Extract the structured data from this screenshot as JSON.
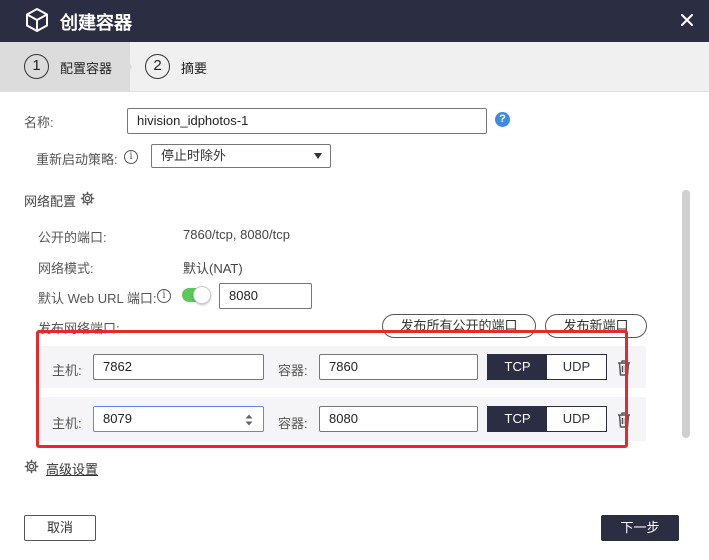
{
  "dialog": {
    "title": "创建容器",
    "title_icon": "cube-icon",
    "close_icon": "close-icon"
  },
  "steps": [
    {
      "number": "1",
      "label": "配置容器",
      "active": true
    },
    {
      "number": "2",
      "label": "摘要",
      "active": false
    }
  ],
  "form": {
    "name_label": "名称:",
    "name_value": "hivision_idphotos-1",
    "restart_label": "重新启动策略:",
    "restart_value": "停止时除外",
    "network_section": "网络配置",
    "published_ports_label": "公开的端口:",
    "published_ports_value": "7860/tcp, 8080/tcp",
    "network_mode_label": "网络模式:",
    "network_mode_value": "默认(NAT)",
    "web_url_port_label": "默认 Web URL 端口:",
    "web_url_port_value": "8080",
    "publish_ports_label": "发布网络端口:",
    "publish_all_button": "发布所有公开的端口",
    "publish_new_button": "发布新端口",
    "port_rows": [
      {
        "host_label": "主机:",
        "host_value": "7862",
        "container_label": "容器:",
        "container_value": "7860",
        "tcp": "TCP",
        "udp": "UDP"
      },
      {
        "host_label": "主机:",
        "host_value": "8079",
        "container_label": "容器:",
        "container_value": "8080",
        "tcp": "TCP",
        "udp": "UDP"
      }
    ],
    "advanced_settings": "高级设置"
  },
  "footer": {
    "cancel": "取消",
    "next": "下一步"
  },
  "colors": {
    "titlebar": "#2b2d42",
    "accent": "#2b2d42",
    "toggle_on": "#5cc95c",
    "highlight": "#e8292b",
    "help": "#3f8be0"
  }
}
